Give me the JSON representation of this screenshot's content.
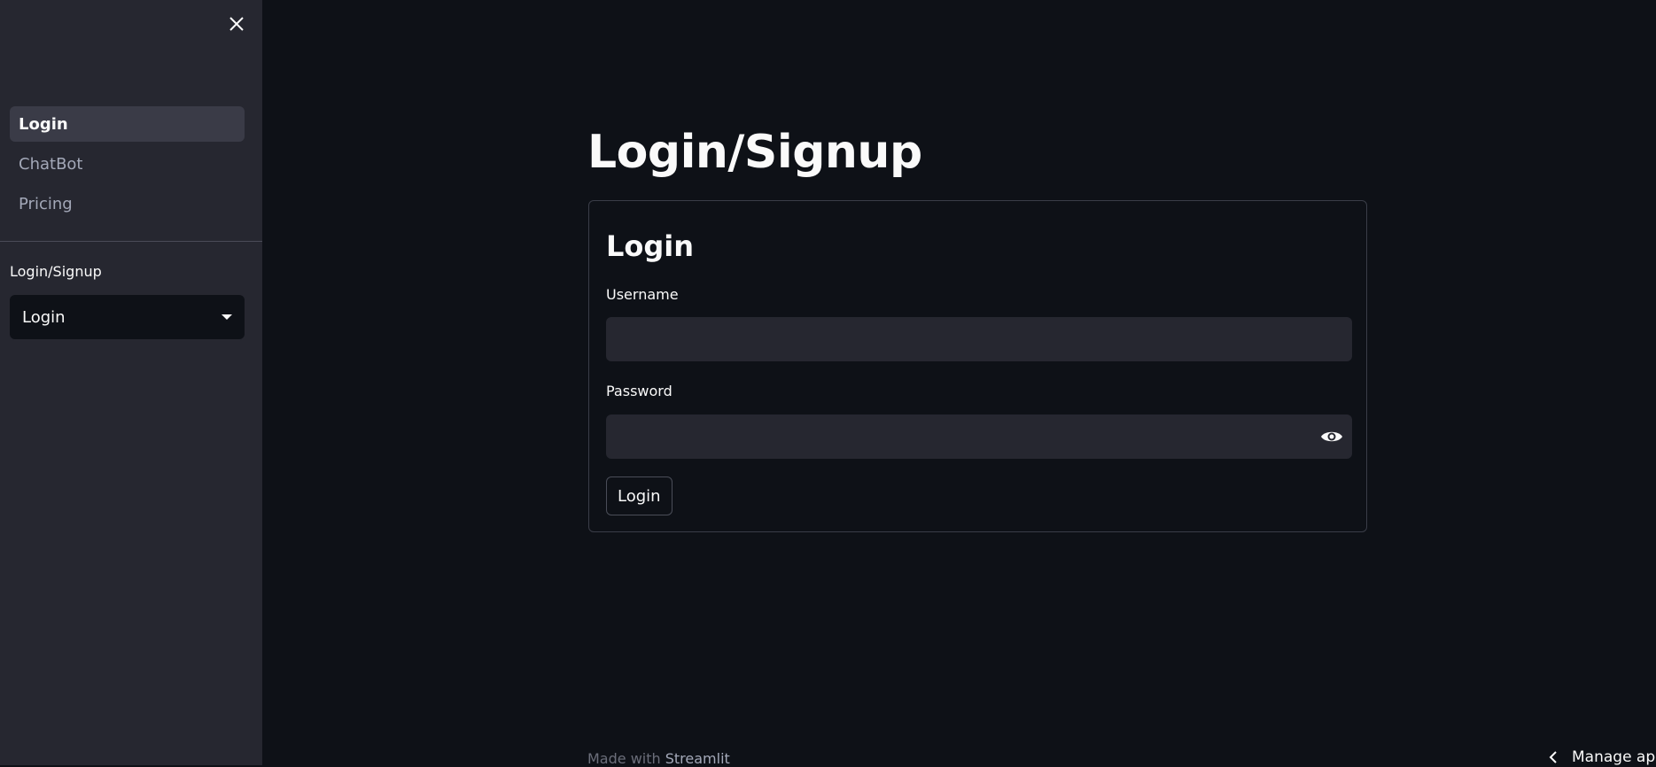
{
  "sidebar": {
    "nav_items": [
      {
        "label": "Login"
      },
      {
        "label": "ChatBot"
      },
      {
        "label": "Pricing"
      }
    ],
    "select_label": "Login/Signup",
    "select_value": "Login"
  },
  "main": {
    "title": "Login/Signup",
    "form": {
      "heading": "Login",
      "username_label": "Username",
      "password_label": "Password",
      "submit_label": "Login"
    }
  },
  "footer": {
    "made_with": "Made with",
    "brand": "Streamlit",
    "manage_app": "Manage ap"
  }
}
